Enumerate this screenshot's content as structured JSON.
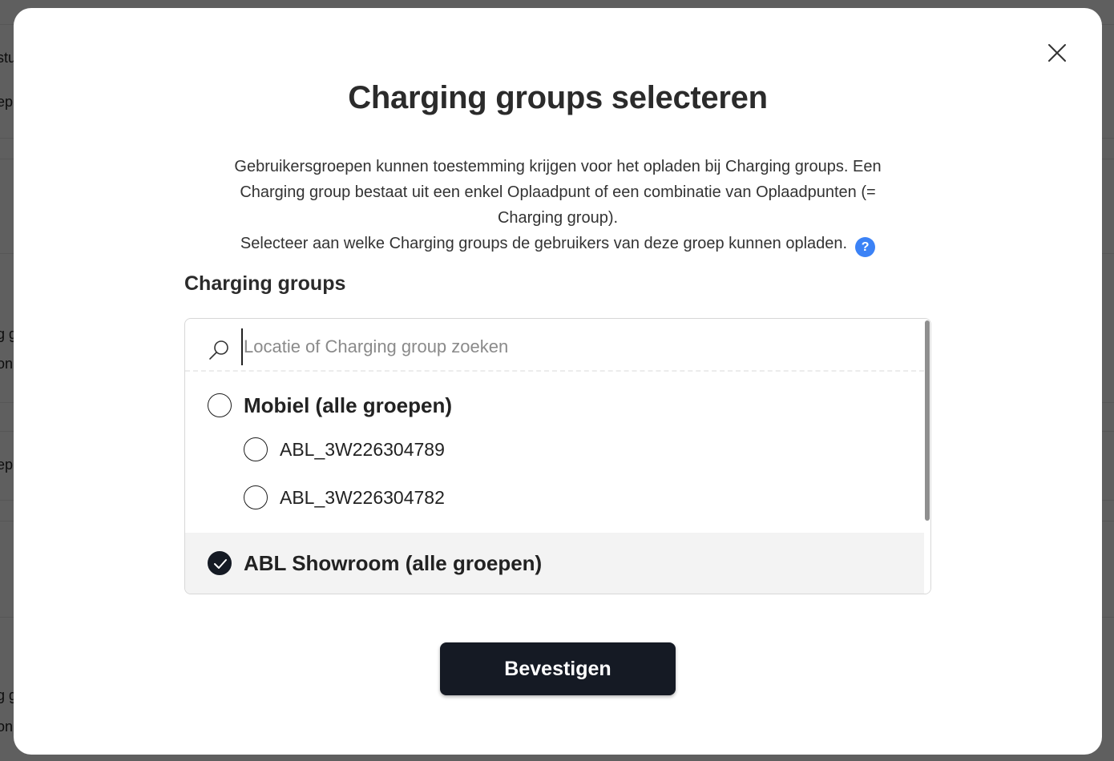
{
  "background": {
    "fragments": [
      "stu",
      "ep",
      "g g",
      "on",
      "ep",
      "g g",
      "on"
    ]
  },
  "modal": {
    "title": "Charging groups selecteren",
    "description_1": "Gebruikersgroepen kunnen toestemming krijgen voor het opladen bij Charging groups. Een Charging group bestaat uit een enkel Oplaadpunt of een combinatie van Oplaadpunten (= Charging group).",
    "description_2": "Selecteer aan welke Charging groups de gebruikers van deze groep kunnen opladen.",
    "help_glyph": "?",
    "section_label": "Charging groups",
    "search": {
      "placeholder": "Locatie of Charging group zoeken",
      "value": ""
    },
    "items": [
      {
        "label": "Mobiel (alle groepen)",
        "level": "group",
        "checked": false
      },
      {
        "label": "ABL_3W226304789",
        "level": "child",
        "checked": false
      },
      {
        "label": "ABL_3W226304782",
        "level": "child",
        "checked": false
      },
      {
        "label": "ABL Showroom (alle groepen)",
        "level": "group",
        "checked": true
      }
    ],
    "confirm_label": "Bevestigen"
  },
  "colors": {
    "accent": "#3b82f6",
    "primary_button": "#151a24"
  },
  "icons": {
    "close": "close-icon",
    "search": "search-icon",
    "help": "help-icon",
    "check": "check-icon"
  }
}
